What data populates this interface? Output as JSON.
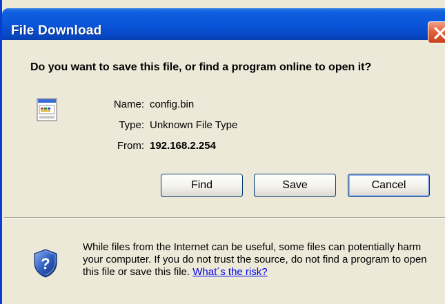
{
  "window": {
    "title": "File Download",
    "close_icon": "close-icon"
  },
  "question": "Do you want to save this file, or find a program online to open it?",
  "file": {
    "icon": "file-icon",
    "name_label": "Name:",
    "name_value": "config.bin",
    "type_label": "Type:",
    "type_value": "Unknown File Type",
    "from_label": "From:",
    "from_value": "192.168.2.254"
  },
  "buttons": {
    "find": "Find",
    "save": "Save",
    "cancel": "Cancel"
  },
  "warning": {
    "icon": "shield-question-icon",
    "text": "While files from the Internet can be useful, some files can potentially harm your computer. If you do not trust the source, do not find a program to open this file or save this file.",
    "link": "What´s the risk?"
  },
  "colors": {
    "titlebar": "#0a54d8",
    "dialog_bg": "#ece9d8",
    "close_button": "#e3633e",
    "link": "#0000ee"
  }
}
